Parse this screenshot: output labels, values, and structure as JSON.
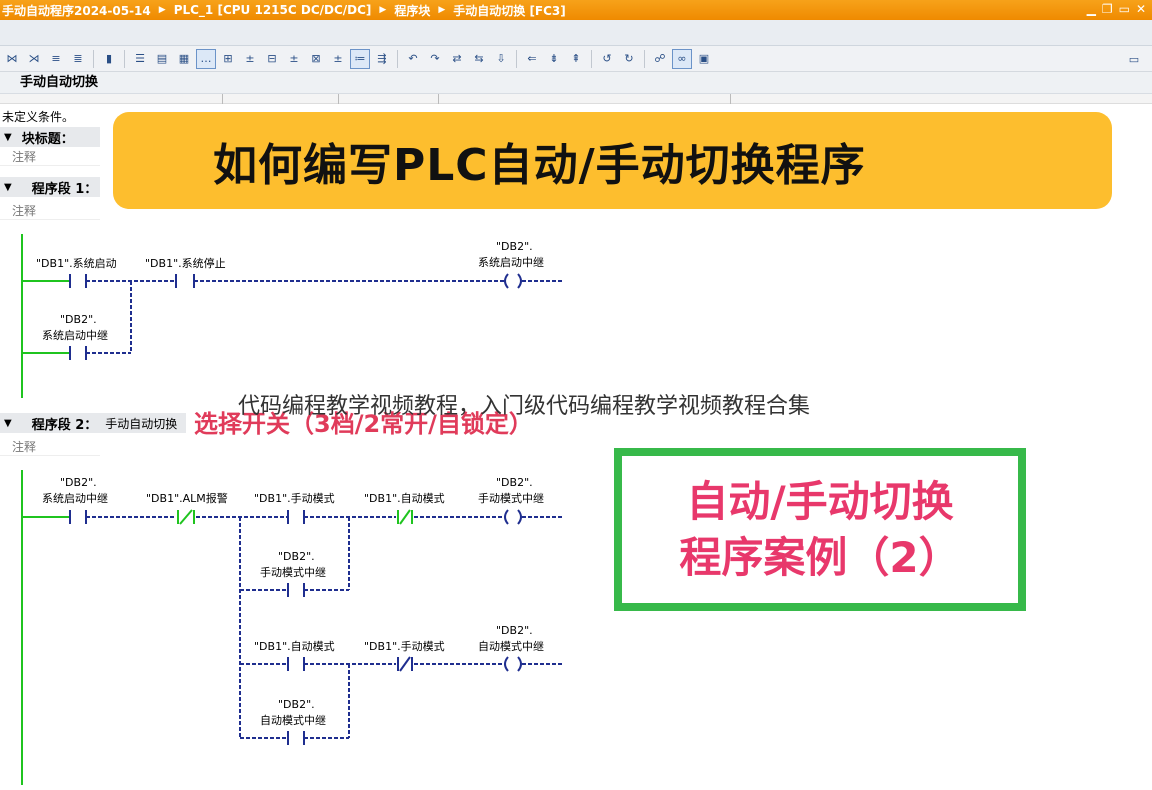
{
  "title": {
    "project": "手动自动程序2024-05-14",
    "device": "PLC_1 [CPU 1215C DC/DC/DC]",
    "folder": "程序块",
    "block": "手动自动切换 [FC3]"
  },
  "block_name": "手动自动切换",
  "undefined_condition": "未定义条件。",
  "block_title": "块标题：",
  "comment_label": "注释",
  "network1": {
    "label": "程序段 1："
  },
  "network2": {
    "label": "程序段 2：",
    "title": "手动自动切换"
  },
  "banner": "如何编写PLC自动/手动切换程序",
  "overlay_caption": "代码编程教学视频教程，入门级代码编程教学视频教程合集",
  "selector_note": "选择开关（3档/2常开/自锁定）",
  "greenbox": {
    "line1": "自动/手动切换",
    "line2": "程序案例（2）"
  },
  "rung1": {
    "c1": "\"DB1\".系统启动",
    "c2": "\"DB1\".系统停止",
    "coil_db": "\"DB2\".",
    "coil": "系统启动中继",
    "p_db": "\"DB2\".",
    "p": "系统启动中继"
  },
  "rung2": {
    "c1_db": "\"DB2\".",
    "c1": "系统启动中继",
    "c2": "\"DB1\".ALM报警",
    "c3": "\"DB1\".手动模式",
    "c4": "\"DB1\".自动模式",
    "coil_db": "\"DB2\".",
    "coil": "手动模式中继",
    "p_db": "\"DB2\".",
    "p": "手动模式中继"
  },
  "rung3": {
    "c1": "\"DB1\".自动模式",
    "c2": "\"DB1\".手动模式",
    "coil_db": "\"DB2\".",
    "coil": "自动模式中继",
    "p_db": "\"DB2\".",
    "p": "自动模式中继"
  },
  "colors": {
    "titlebar": "#f7a21a",
    "banner": "#fdbe2e",
    "green": "#37b94a",
    "pink": "#e8386b",
    "wire": "#1f2e8f",
    "power": "#1fc41f"
  }
}
